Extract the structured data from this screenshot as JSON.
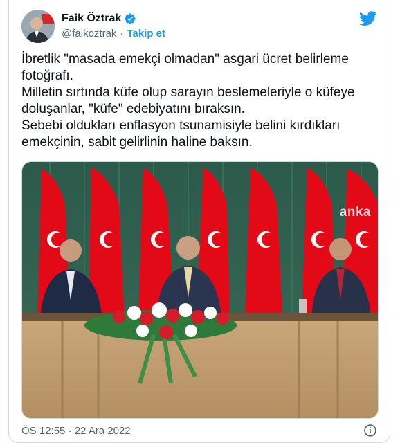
{
  "tweet": {
    "author_name": "Faik Öztrak",
    "handle": "@faikoztrak",
    "separator": "·",
    "follow_label": "Takip et",
    "text": "İbretlik \"masada emekçi olmadan\" asgari ücret belirleme fotoğrafı.\nMilletin sırtında küfe olup sarayın beslemeleriyle o küfeye doluşanlar, \"küfe\" edebiyatını bıraksın.\nSebebi oldukları enflasyon tsunamisiyle belini kırdıkları emekçinin, sabit gelirlinin haline baksın.",
    "timestamp": "ÖS 12:55 · 22 Ara 2022"
  },
  "media": {
    "watermark": "anka"
  },
  "icons": {
    "verified": "verified-badge-icon",
    "twitter": "twitter-bird-icon",
    "info": "info-icon"
  },
  "colors": {
    "accent": "#1d9bf0",
    "flag_red": "#e30a17",
    "backdrop_green": "#2f5f4f"
  }
}
